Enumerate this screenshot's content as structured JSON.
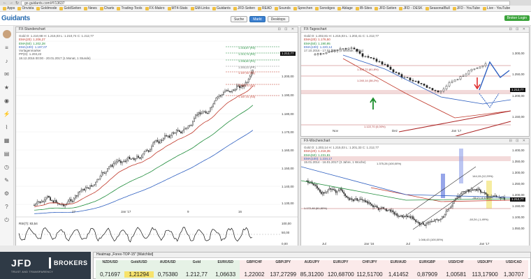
{
  "browser": {
    "url": "go.guidants.com/#!/13637",
    "bookmarks": [
      "Apps",
      "Onvista",
      "Goldmode",
      "GoldSeiten",
      "News",
      "Charts",
      "Trading-Tools",
      "FX-Makro",
      "MT4-Stats",
      "GM-Links",
      "Guidants",
      "JFD-Seiten",
      "READ",
      "Sounds",
      "Sprechen",
      "Sonstiges",
      "Ablage",
      "IB-Sites",
      "JFD-Seiten",
      "JFD - DESK",
      "SeasonalBull",
      "JFD - YouTube",
      "Live - YouTube"
    ]
  },
  "header": {
    "logo": "Guidants",
    "buttons": [
      "Suche",
      "Markt",
      "Desktops"
    ],
    "broker_button": "Broker Login"
  },
  "sidebar": {
    "icons": [
      "avatar",
      "menu-icon",
      "bell-icon",
      "message-icon",
      "star-icon",
      "eye-icon",
      "bolt-icon",
      "chart-icon",
      "calendar-icon",
      "grid-icon",
      "clock-icon",
      "wrench-icon",
      "gear-icon",
      "question-icon",
      "power-icon"
    ]
  },
  "panels": {
    "left": {
      "title": "FX-Stundenchart",
      "legend": [
        {
          "text": "Gold   O: 1.210,98   H: 1.215,03   L: 1.210,74   C: 1.212,77",
          "color": "gray"
        },
        {
          "text": "EMA(20): 1.206,27",
          "color": "red"
        },
        {
          "text": "EMA(50): 1.202,28",
          "color": "green"
        },
        {
          "text": "EMA(100): 1.197,07",
          "color": "blue"
        },
        {
          "text": "Vorlagenmarker",
          "color": "gray"
        },
        {
          "text": "PP(D): 1.203,22",
          "color": "gray"
        },
        {
          "text": "18.12.2016 00:00 - 20.01.2017   (1 Monat, 1 Stunde)",
          "color": "gray"
        }
      ],
      "price_tag": "1.212,77",
      "levels": [
        "1.218,87 (R3)",
        "1.213,74 (R2)",
        "1.208,60 (R1)",
        "1.203,22 (PP)",
        "1.197,92 (S1)",
        "1.192,70 (S2)",
        "1.187,31 (S3)"
      ],
      "y_ticks": [
        "1.200,00",
        "1.190,00",
        "1.180,00",
        "1.170,00",
        "1.160,00",
        "1.150,00",
        "1.140,00",
        "1.130,00"
      ],
      "x_ticks": [
        "27",
        "Jan '17",
        "9",
        "16"
      ],
      "rsi_label": "RSI(7): 83,54",
      "rsi_ticks": [
        "100,00",
        "50,00",
        "0,00"
      ]
    },
    "top_right": {
      "title": "FX-Tageschart",
      "legend": [
        {
          "text": "Gold   O: 1.202,81   H: 1.215,03   L: 1.202,41   C: 1.212,77",
          "color": "gray"
        },
        {
          "text": "EMA(20): 1.176,50",
          "color": "red"
        },
        {
          "text": "EMA(50): 1.190,95",
          "color": "green"
        },
        {
          "text": "EMA(100): 1.220,14",
          "color": "blue"
        },
        {
          "text": "17.10.2016 - 17.01.2017   (3 Monate, 1 Tag)",
          "color": "gray"
        }
      ],
      "price_tag": "1.212,77",
      "fib_labels": [
        "1.303,72 (61,8%)",
        "1.240,14 (38,2%)",
        "1.122,70 (0,00%)"
      ],
      "y_ticks": [
        "1.300,00",
        "1.250,00",
        "1.200,00",
        "1.150,00"
      ],
      "x_ticks": [
        "Nov",
        "Dez",
        "Jan '17"
      ]
    },
    "bottom_right": {
      "title": "FX-Wochenchart",
      "legend": [
        {
          "text": "Gold   O: 1.203,14   H: 1.215,03   L: 1.201,33   C: 1.212,77",
          "color": "gray"
        },
        {
          "text": "EMA(20): 1.218,35",
          "color": "red"
        },
        {
          "text": "EMA(50): 1.231,81",
          "color": "green"
        },
        {
          "text": "EMA(100): 1.234,17",
          "color": "blue"
        },
        {
          "text": "15.01.2014 - 16.01.2017   (3 Jahre, 1 Woche)",
          "color": "gray"
        }
      ],
      "price_tag": "1.212,77",
      "annotations": [
        "1.375,28 (100,00%)",
        "1.172,48 (61,80%)",
        "144,15 (12,29%)",
        "-56,2 (-4,12%)",
        "-18,24 (-1,49%)",
        "1.046,43 (100,00%)"
      ],
      "y_ticks": [
        "1.400,00",
        "1.350,00",
        "1.300,00",
        "1.250,00",
        "1.200,00",
        "1.150,00",
        "1.100,00",
        "1.050,00"
      ],
      "x_ticks": [
        "Jul",
        "Jan '16",
        "Jul",
        "Jan '17"
      ]
    }
  },
  "jfd": {
    "brand": "JFD",
    "suffix": "BROKERS",
    "tagline": "TRUST  AND  TRANSPARENCY"
  },
  "heatmap": {
    "title": "Heatmap „Forex-TOP-15\" [Watchlist]",
    "cells": [
      {
        "sym": "NZD/USD",
        "price": "0,71697",
        "state": "pos"
      },
      {
        "sym": "Gold/USD",
        "price": "1,21294",
        "state": "pos"
      },
      {
        "sym": "AUD/USD",
        "price": "0,75380",
        "state": "pos"
      },
      {
        "sym": "Gold",
        "price": "1.212,77",
        "state": "pos"
      },
      {
        "sym": "EUR/USD",
        "price": "1,06633",
        "state": "pos"
      },
      {
        "sym": "GBP/CHF",
        "price": "1,22002",
        "state": "neg"
      },
      {
        "sym": "GBP/JPY",
        "price": "137,27299",
        "state": "neg"
      },
      {
        "sym": "AUD/JPY",
        "price": "85,31200",
        "state": "neg"
      },
      {
        "sym": "EUR/JPY",
        "price": "120,68700",
        "state": "neg"
      },
      {
        "sym": "CHF/JPY",
        "price": "112,51700",
        "state": "neg"
      },
      {
        "sym": "EUR/AUD",
        "price": "1,41452",
        "state": "neg"
      },
      {
        "sym": "EUR/GBP",
        "price": "0,87909",
        "state": "neg"
      },
      {
        "sym": "USD/CHF",
        "price": "1,00581",
        "state": "neg"
      },
      {
        "sym": "USD/JPY",
        "price": "113,17900",
        "state": "neg"
      },
      {
        "sym": "USD/CAD",
        "price": "1,30707",
        "state": "neg"
      }
    ]
  },
  "colors": {
    "accent": "#2a6db0",
    "ema20": "#c0392b",
    "ema50": "#1e8c3a",
    "ema100": "#2e5fc0",
    "pos": "#e6f2e6",
    "neg": "#fbeaea"
  }
}
